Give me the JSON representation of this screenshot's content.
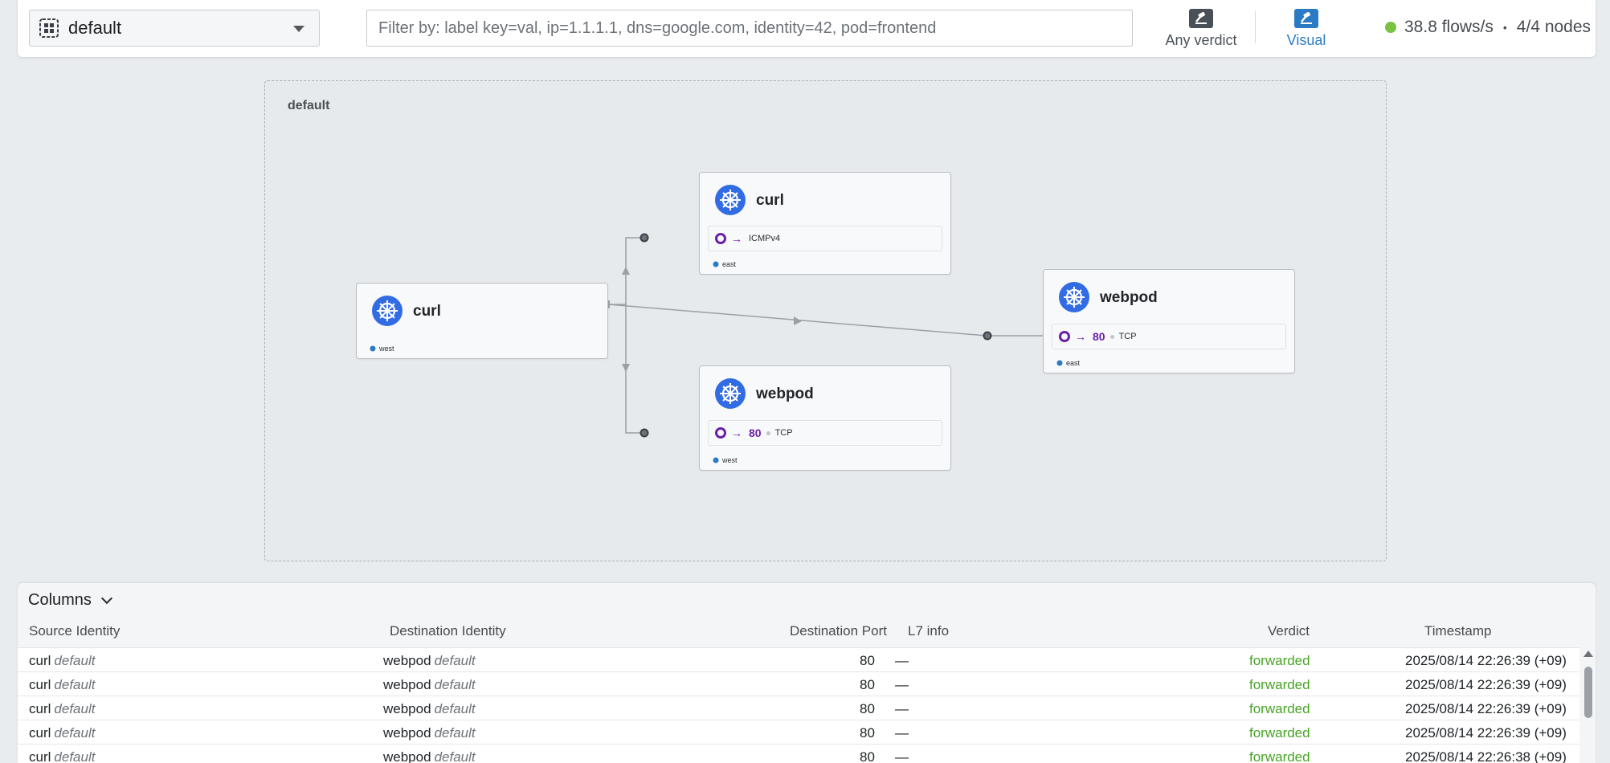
{
  "topbar": {
    "namespace": "default",
    "filter_placeholder": "Filter by: label key=val, ip=1.1.1.1, dns=google.com, identity=42, pod=frontend",
    "verdict_label": "Any verdict",
    "visual_label": "Visual",
    "flows_rate": "38.8 flows/s",
    "status_separator": "•",
    "nodes": "4/4 nodes",
    "status_color": "#7cc142"
  },
  "graph": {
    "namespace_box_title": "default",
    "cards": [
      {
        "title": "curl",
        "cluster": "west",
        "icon": "kubernetes-icon"
      },
      {
        "title": "curl",
        "cluster": "east",
        "port": "",
        "protocol": "ICMPv4",
        "icon": "kubernetes-icon"
      },
      {
        "title": "webpod",
        "cluster": "west",
        "port": "80",
        "protocol": "TCP",
        "icon": "kubernetes-icon"
      },
      {
        "title": "webpod",
        "cluster": "east",
        "port": "80",
        "protocol": "TCP",
        "icon": "kubernetes-icon"
      }
    ],
    "accent_color": "#6a1fa8",
    "k8s_color": "#326ce5"
  },
  "flows": {
    "columns_label": "Columns",
    "headers": {
      "source": "Source Identity",
      "destination": "Destination Identity",
      "port": "Destination Port",
      "l7": "L7 info",
      "verdict": "Verdict",
      "timestamp": "Timestamp"
    },
    "rows": [
      {
        "src": "curl",
        "src_ns": "default",
        "dst": "webpod",
        "dst_ns": "default",
        "port": "80",
        "l7": "—",
        "verdict": "forwarded",
        "time": "2025/08/14 22:26:39 (+09)"
      },
      {
        "src": "curl",
        "src_ns": "default",
        "dst": "webpod",
        "dst_ns": "default",
        "port": "80",
        "l7": "—",
        "verdict": "forwarded",
        "time": "2025/08/14 22:26:39 (+09)"
      },
      {
        "src": "curl",
        "src_ns": "default",
        "dst": "webpod",
        "dst_ns": "default",
        "port": "80",
        "l7": "—",
        "verdict": "forwarded",
        "time": "2025/08/14 22:26:39 (+09)"
      },
      {
        "src": "curl",
        "src_ns": "default",
        "dst": "webpod",
        "dst_ns": "default",
        "port": "80",
        "l7": "—",
        "verdict": "forwarded",
        "time": "2025/08/14 22:26:39 (+09)"
      },
      {
        "src": "curl",
        "src_ns": "default",
        "dst": "webpod",
        "dst_ns": "default",
        "port": "80",
        "l7": "—",
        "verdict": "forwarded",
        "time": "2025/08/14 22:26:38 (+09)"
      }
    ]
  }
}
